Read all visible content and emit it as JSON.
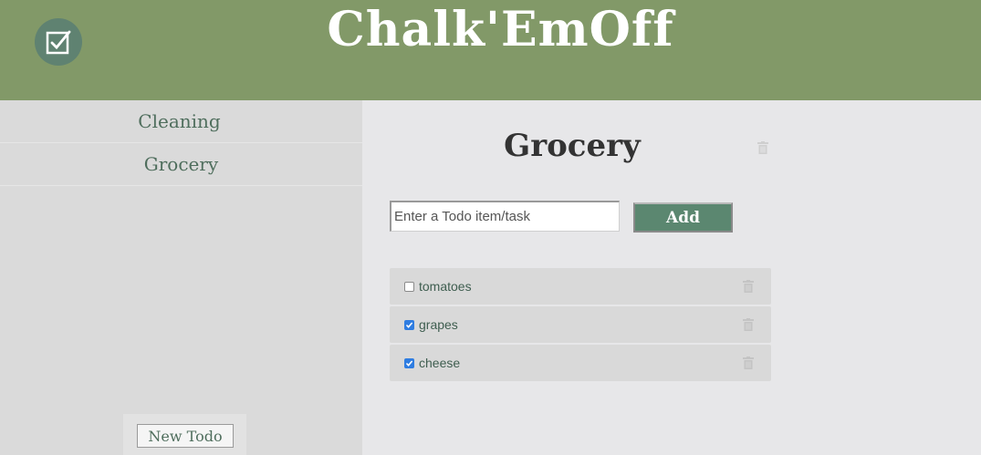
{
  "header": {
    "title": "Chalk'EmOff",
    "logo_icon": "checkbox-icon"
  },
  "sidebar": {
    "items": [
      {
        "label": "Cleaning"
      },
      {
        "label": "Grocery"
      }
    ],
    "new_todo_label": "New Todo"
  },
  "main": {
    "title": "Grocery",
    "delete_icon": "trash-icon",
    "input": {
      "value": "",
      "placeholder": "Enter a Todo item/task"
    },
    "add_label": "Add",
    "todos": [
      {
        "text": "tomatoes",
        "checked": false
      },
      {
        "text": "grapes",
        "checked": true
      },
      {
        "text": "cheese",
        "checked": true
      }
    ]
  },
  "colors": {
    "header_bg": "#829968",
    "accent": "#5b8770",
    "text_green": "#4f6e5d"
  }
}
